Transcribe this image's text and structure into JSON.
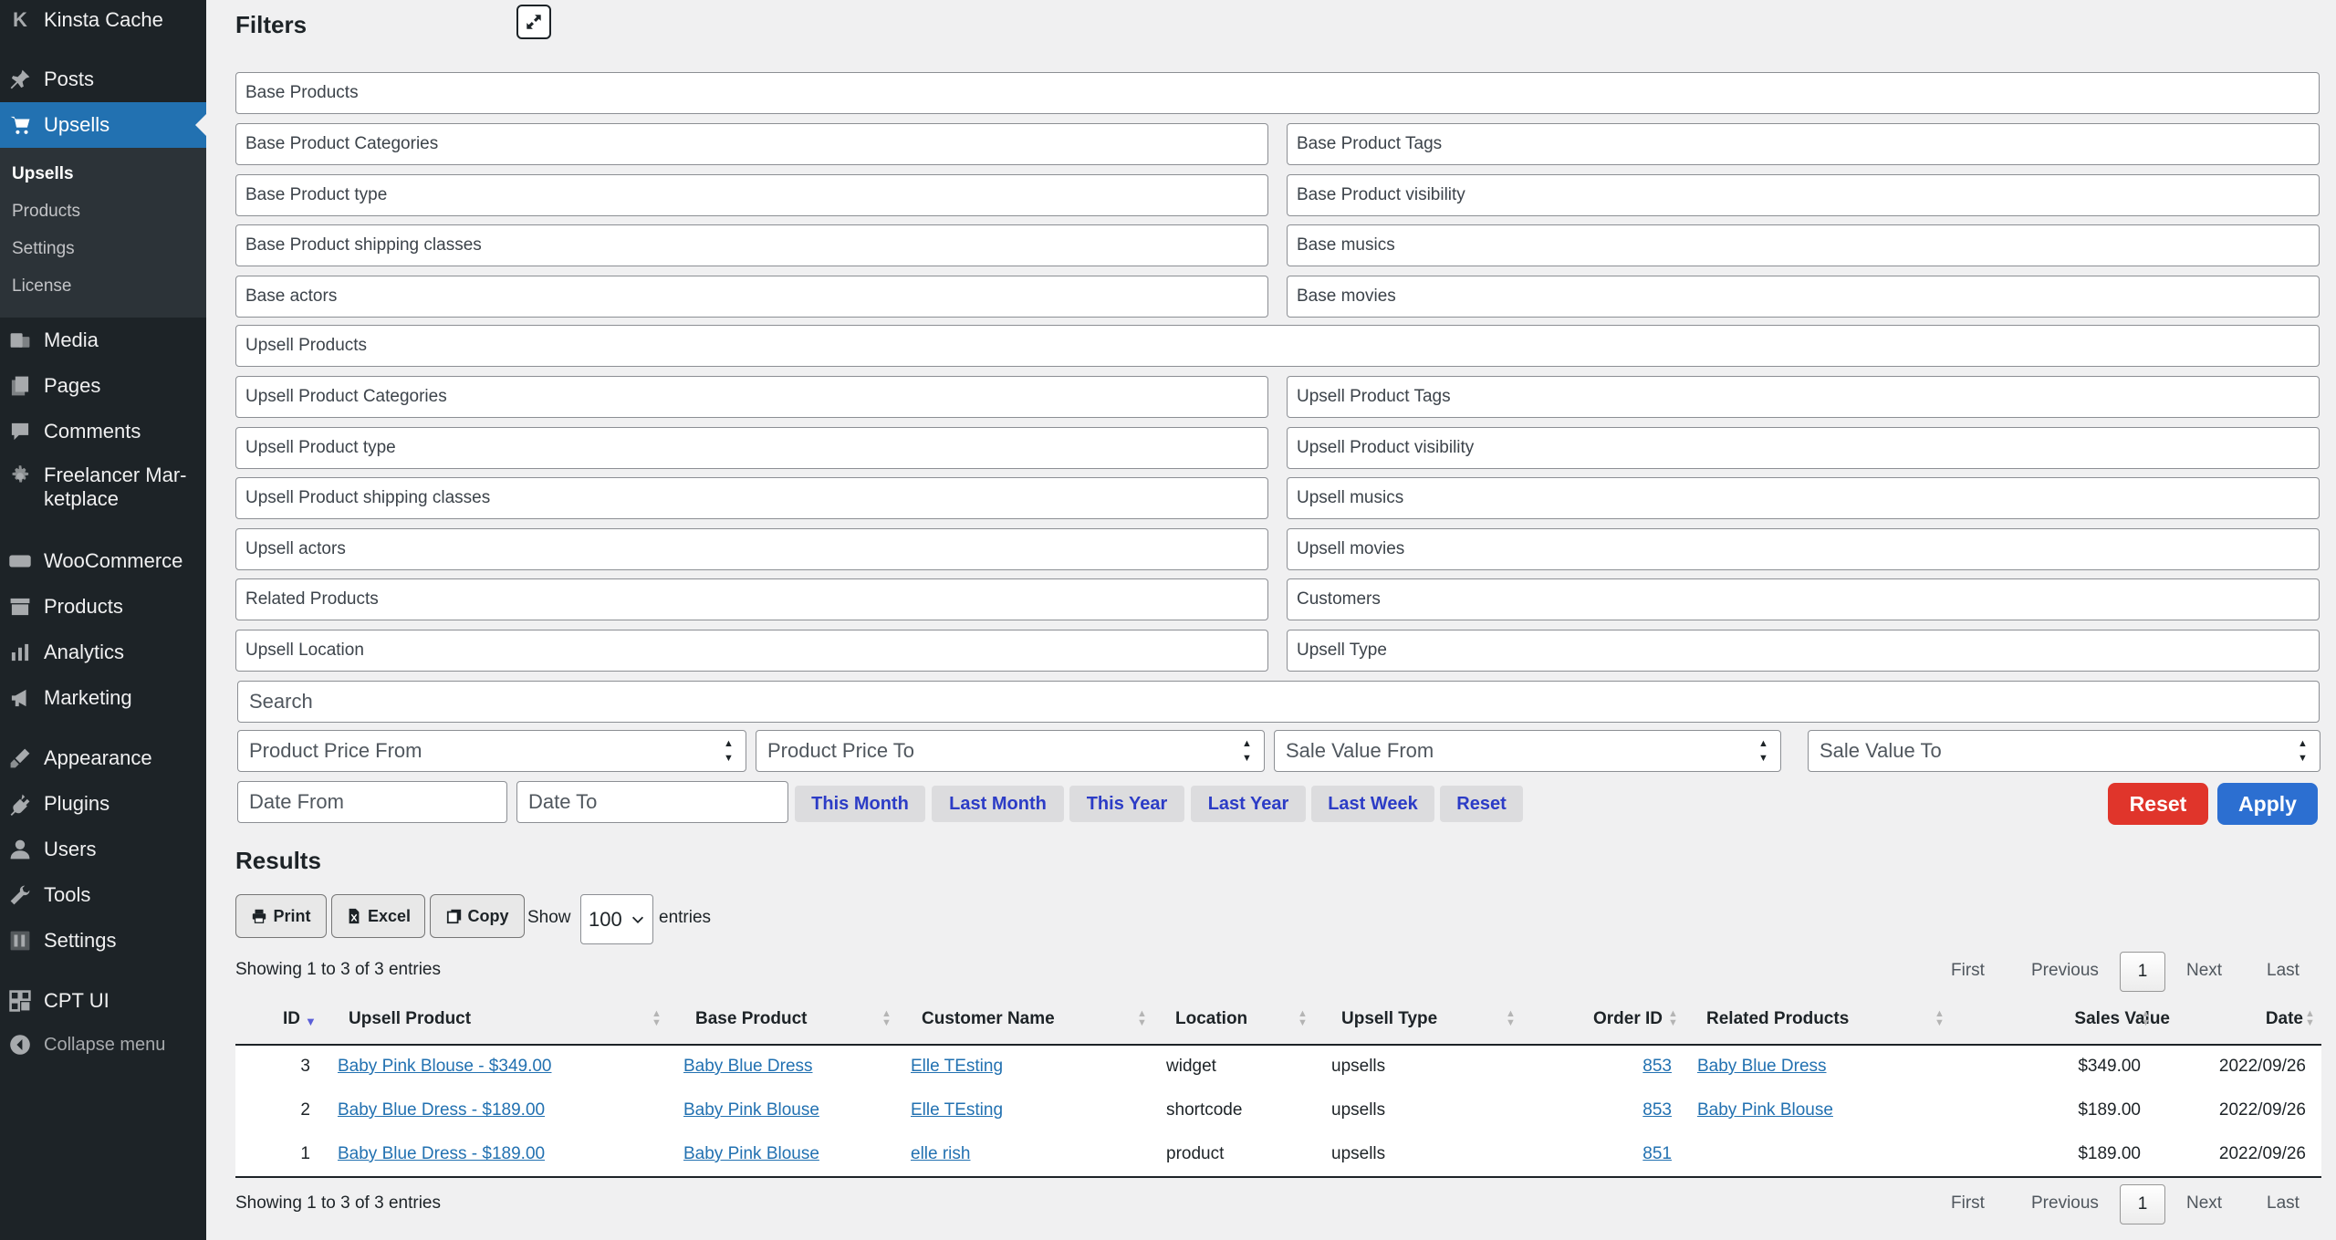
{
  "sidebar": {
    "top_item": "Kinsta Cache",
    "items": [
      {
        "label": "Posts",
        "icon": "pin-icon"
      },
      {
        "label": "Upsells",
        "icon": "cart-icon",
        "active": true
      },
      {
        "label": "Media",
        "icon": "media-icon"
      },
      {
        "label": "Pages",
        "icon": "pages-icon"
      },
      {
        "label": "Comments",
        "icon": "comment-icon"
      },
      {
        "label": "Freelancer Mar-\nketplace",
        "icon": "gear-icon"
      },
      {
        "label": "WooCommerce",
        "icon": "woo-icon"
      },
      {
        "label": "Products",
        "icon": "archive-icon"
      },
      {
        "label": "Analytics",
        "icon": "bar-chart-icon"
      },
      {
        "label": "Marketing",
        "icon": "megaphone-icon"
      },
      {
        "label": "Appearance",
        "icon": "brush-icon"
      },
      {
        "label": "Plugins",
        "icon": "plug-icon"
      },
      {
        "label": "Users",
        "icon": "user-icon"
      },
      {
        "label": "Tools",
        "icon": "wrench-icon"
      },
      {
        "label": "Settings",
        "icon": "settings-icon"
      },
      {
        "label": "CPT UI",
        "icon": "grid-icon"
      }
    ],
    "submenu": [
      "Upsells",
      "Products",
      "Settings",
      "License"
    ],
    "collapse": "Collapse menu"
  },
  "filters": {
    "title": "Filters",
    "base_products": "Base Products",
    "base_grid": [
      "Base Product Categories",
      "Base Product Tags",
      "Base Product type",
      "Base Product visibility",
      "Base Product shipping classes",
      "Base musics",
      "Base actors",
      "Base movies"
    ],
    "upsell_products": "Upsell Products",
    "upsell_grid": [
      "Upsell Product Categories",
      "Upsell Product Tags",
      "Upsell Product type",
      "Upsell Product visibility",
      "Upsell Product shipping classes",
      "Upsell musics",
      "Upsell actors",
      "Upsell movies",
      "Related Products",
      "Customers",
      "Upsell Location",
      "Upsell Type"
    ],
    "search_placeholder": "Search",
    "numeric": [
      "Product Price From",
      "Product Price To",
      "Sale Value From",
      "Sale Value To"
    ],
    "date_from": "Date From",
    "date_to": "Date To",
    "quick": [
      "This Month",
      "Last Month",
      "This Year",
      "Last Year",
      "Last Week",
      "Reset"
    ],
    "reset_label": "Reset",
    "apply_label": "Apply"
  },
  "results": {
    "title": "Results",
    "print": "Print",
    "excel": "Excel",
    "copy": "Copy",
    "show": "Show",
    "entries_count": "100",
    "entries": "entries",
    "showing_top": "Showing 1 to 3 of 3 entries",
    "showing_bottom": "Showing 1 to 3 of 3 entries",
    "pager": {
      "first": "First",
      "previous": "Previous",
      "page": "1",
      "next": "Next",
      "last": "Last"
    },
    "columns": [
      "ID",
      "Upsell Product",
      "Base Product",
      "Customer Name",
      "Location",
      "Upsell Type",
      "Order ID",
      "Related Products",
      "Sales Value",
      "Date"
    ],
    "rows": [
      {
        "id": "3",
        "upsell": "Baby Pink Blouse - $349.00",
        "base": "Baby Blue Dress",
        "customer": "Elle TEsting",
        "location": "widget",
        "type": "upsells",
        "order": "853",
        "related": "Baby Blue Dress",
        "value": "$349.00",
        "date": "2022/09/26"
      },
      {
        "id": "2",
        "upsell": "Baby Blue Dress - $189.00",
        "base": "Baby Pink Blouse",
        "customer": "Elle TEsting",
        "location": "shortcode",
        "type": "upsells",
        "order": "853",
        "related": "Baby Pink Blouse",
        "value": "$189.00",
        "date": "2022/09/26"
      },
      {
        "id": "1",
        "upsell": "Baby Blue Dress - $189.00",
        "base": "Baby Pink Blouse",
        "customer": "elle rish",
        "location": "product",
        "type": "upsells",
        "order": "851",
        "related": "",
        "value": "$189.00",
        "date": "2022/09/26"
      }
    ]
  },
  "colors": {
    "admin_bar": "#1d2327",
    "active": "#2271b1",
    "reset": "#e0352b",
    "apply": "#2c6fd1",
    "link": "#2271b1"
  }
}
